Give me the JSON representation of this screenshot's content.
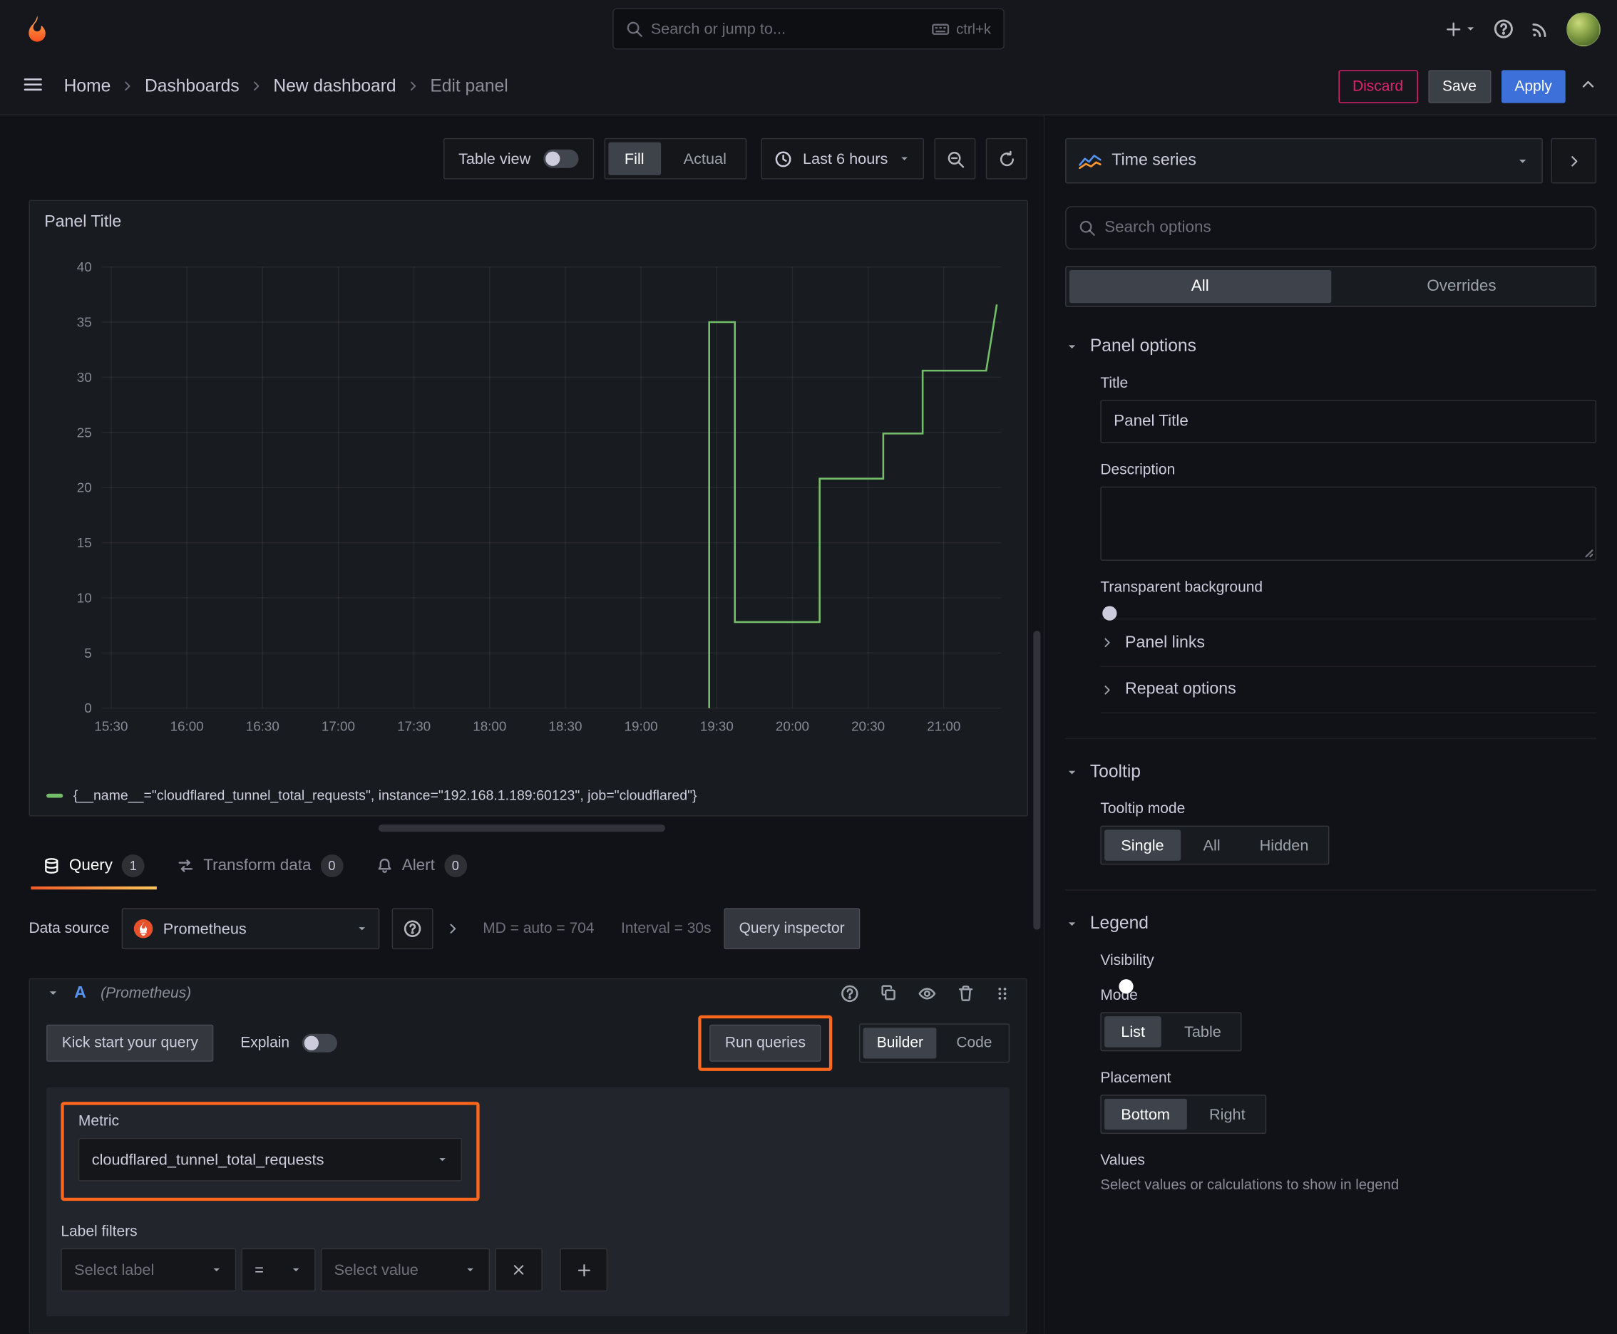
{
  "topnav": {
    "search_placeholder": "Search or jump to...",
    "shortcut": "ctrl+k"
  },
  "breadcrumb": {
    "items": [
      "Home",
      "Dashboards",
      "New dashboard",
      "Edit panel"
    ],
    "discard_label": "Discard",
    "save_label": "Save",
    "apply_label": "Apply"
  },
  "panel_toolbar": {
    "table_view_label": "Table view",
    "fill_label": "Fill",
    "actual_label": "Actual",
    "time_range_label": "Last 6 hours"
  },
  "panel": {
    "title": "Panel Title"
  },
  "chart_data": {
    "type": "line",
    "title": "Panel Title",
    "x_ticks": [
      "15:30",
      "16:00",
      "16:30",
      "17:00",
      "17:30",
      "18:00",
      "18:30",
      "19:00",
      "19:30",
      "20:00",
      "20:30",
      "21:00"
    ],
    "x_tick_hours": [
      15.5,
      16,
      16.5,
      17,
      17.5,
      18,
      18.5,
      19,
      19.5,
      20,
      20.5,
      21
    ],
    "x_domain": [
      15.44,
      21.38
    ],
    "y_ticks": [
      0,
      5,
      10,
      15,
      20,
      25,
      30,
      35,
      40
    ],
    "ylim": [
      0,
      40
    ],
    "grid": true,
    "legend_position": "bottom",
    "series": [
      {
        "name": "{__name__=\"cloudflared_tunnel_total_requests\", instance=\"192.168.1.189:60123\", job=\"cloudflared\"}",
        "color": "#73bf69",
        "points": [
          [
            19.45,
            0
          ],
          [
            19.45,
            35
          ],
          [
            19.62,
            35
          ],
          [
            19.62,
            7.8
          ],
          [
            20.18,
            7.8
          ],
          [
            20.18,
            20.8
          ],
          [
            20.6,
            20.8
          ],
          [
            20.6,
            24.9
          ],
          [
            20.86,
            24.9
          ],
          [
            20.86,
            30.6
          ],
          [
            21.28,
            30.6
          ],
          [
            21.35,
            36.6
          ]
        ]
      }
    ]
  },
  "tabs": {
    "query_label": "Query",
    "query_count": "1",
    "transform_label": "Transform data",
    "transform_count": "0",
    "alert_label": "Alert",
    "alert_count": "0"
  },
  "query_bar": {
    "datasource_label": "Data source",
    "datasource_name": "Prometheus",
    "stats_md": "MD = auto = 704",
    "stats_interval": "Interval = 30s",
    "inspector_label": "Query inspector"
  },
  "query_row": {
    "ref_id": "A",
    "ds_hint": "(Prometheus)",
    "kickstart_label": "Kick start your query",
    "explain_label": "Explain",
    "run_label": "Run queries",
    "builder_label": "Builder",
    "code_label": "Code",
    "metric_label": "Metric",
    "metric_value": "cloudflared_tunnel_total_requests",
    "label_filters_label": "Label filters",
    "select_label_placeholder": "Select label",
    "operator": "=",
    "select_value_placeholder": "Select value"
  },
  "viz_picker": {
    "name": "Time series"
  },
  "options_pane": {
    "search_placeholder": "Search options",
    "tab_all": "All",
    "tab_overrides": "Overrides",
    "panel_options_title": "Panel options",
    "title_label": "Title",
    "title_value": "Panel Title",
    "description_label": "Description",
    "transparent_label": "Transparent background",
    "panel_links_title": "Panel links",
    "repeat_title": "Repeat options",
    "tooltip_title": "Tooltip",
    "tooltip_mode_label": "Tooltip mode",
    "tooltip_options": [
      "Single",
      "All",
      "Hidden"
    ],
    "legend_title": "Legend",
    "visibility_label": "Visibility",
    "mode_label": "Mode",
    "mode_options": [
      "List",
      "Table"
    ],
    "placement_label": "Placement",
    "placement_options": [
      "Bottom",
      "Right"
    ],
    "values_label": "Values",
    "values_help": "Select values or calculations to show in legend"
  },
  "colors": {
    "annotation_orange": "#ff671d",
    "apply_blue": "#3d71d9",
    "discard_red": "#e0226e",
    "series_green": "#73bf69",
    "toggle_on_blue": "#3d71d9"
  }
}
